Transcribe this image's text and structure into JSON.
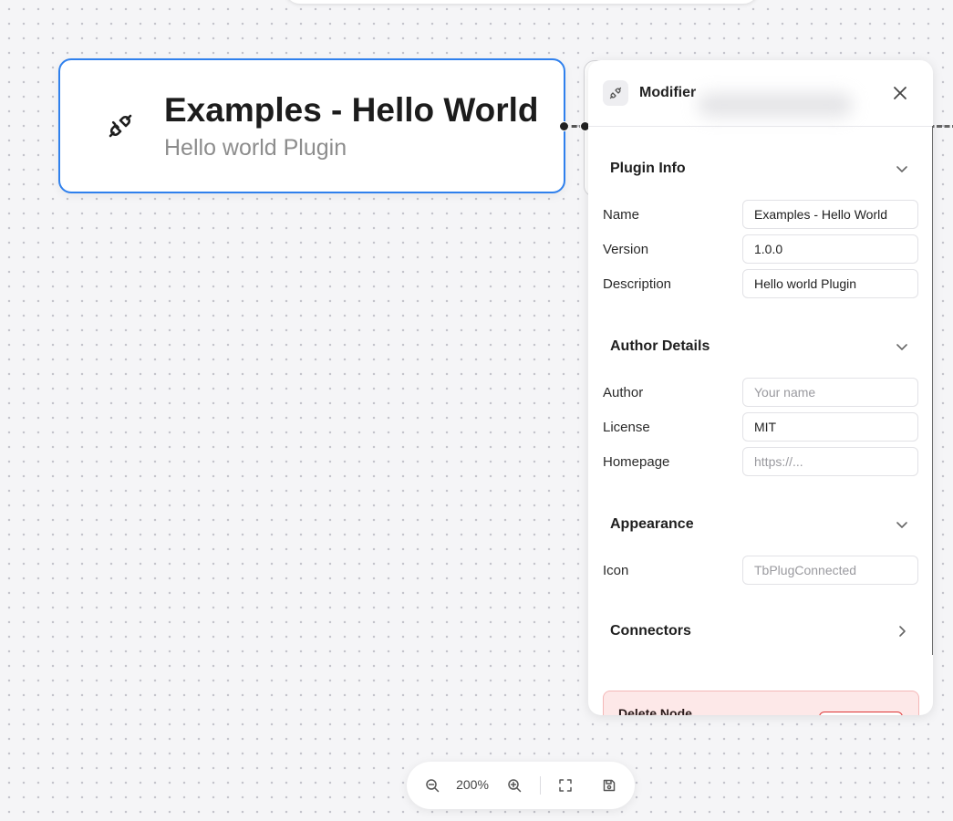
{
  "canvas": {
    "node": {
      "icon": "plug-connected-icon",
      "title": "Examples - Hello World",
      "subtitle": "Hello world Plugin"
    }
  },
  "panel": {
    "title": "Modifier",
    "header_icon": "plug-connected-icon",
    "sections": {
      "plugin_info": {
        "title": "Plugin Info",
        "name_label": "Name",
        "name_value": "Examples - Hello World",
        "version_label": "Version",
        "version_value": "1.0.0",
        "description_label": "Description",
        "description_value": "Hello world Plugin"
      },
      "author_details": {
        "title": "Author Details",
        "author_label": "Author",
        "author_placeholder": "Your name",
        "license_label": "License",
        "license_value": "MIT",
        "homepage_label": "Homepage",
        "homepage_placeholder": "https://..."
      },
      "appearance": {
        "title": "Appearance",
        "icon_label": "Icon",
        "icon_placeholder": "TbPlugConnected"
      },
      "connectors": {
        "title": "Connectors"
      }
    },
    "danger": {
      "title": "Delete Node"
    }
  },
  "zoom": {
    "level": "200%"
  },
  "colors": {
    "accent": "#2f80ed",
    "danger_bg": "#fde8e8",
    "danger_border": "#f4b7b7"
  }
}
